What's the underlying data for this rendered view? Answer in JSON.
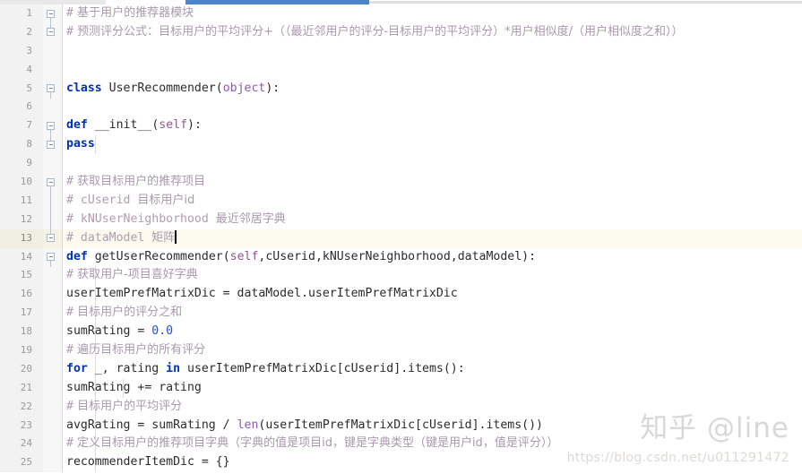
{
  "editor": {
    "language": "python",
    "current_line": 13,
    "gutter_bg": "#f2f2f2",
    "current_line_bg": "#fcfaef",
    "scrollbar": {
      "thumb_color": "#4a86c8",
      "track_color": "#e0e0e0"
    }
  },
  "lines": [
    {
      "num": "1",
      "fold": "start",
      "tokens": [
        {
          "c": "comment",
          "t": "#"
        },
        {
          "c": "comment-cn",
          "t": " 基于用户的推荐器模块"
        }
      ]
    },
    {
      "num": "2",
      "fold": "end",
      "tokens": [
        {
          "c": "comment",
          "t": "#"
        },
        {
          "c": "comment-cn",
          "t": " 预测评分公式：目标用户的平均评分+（（最近邻用户的评分-目标用户的平均评分）*用户相似度/（用户相似度之和））"
        }
      ]
    },
    {
      "num": "3",
      "fold": "none",
      "tokens": []
    },
    {
      "num": "4",
      "fold": "none",
      "tokens": []
    },
    {
      "num": "5",
      "fold": "start",
      "tokens": [
        {
          "c": "kw",
          "t": "class"
        },
        {
          "c": "plain",
          "t": " "
        },
        {
          "c": "cls",
          "t": "UserRecommender"
        },
        {
          "c": "plain",
          "t": "("
        },
        {
          "c": "builtin",
          "t": "object"
        },
        {
          "c": "plain",
          "t": "):"
        }
      ]
    },
    {
      "num": "6",
      "fold": "none",
      "tokens": []
    },
    {
      "num": "7",
      "fold": "start",
      "indent": 1,
      "tokens": [
        {
          "c": "plain",
          "t": "    "
        },
        {
          "c": "def",
          "t": "def"
        },
        {
          "c": "plain",
          "t": " "
        },
        {
          "c": "fn",
          "t": "__init__"
        },
        {
          "c": "plain",
          "t": "("
        },
        {
          "c": "self",
          "t": "self"
        },
        {
          "c": "plain",
          "t": "):"
        }
      ]
    },
    {
      "num": "8",
      "fold": "end",
      "indent": 2,
      "tokens": [
        {
          "c": "plain",
          "t": "        "
        },
        {
          "c": "kw",
          "t": "pass"
        }
      ]
    },
    {
      "num": "9",
      "fold": "none",
      "tokens": []
    },
    {
      "num": "10",
      "fold": "start",
      "indent": 1,
      "tokens": [
        {
          "c": "plain",
          "t": "    "
        },
        {
          "c": "comment",
          "t": "#"
        },
        {
          "c": "comment-cn",
          "t": " 获取目标用户的推荐项目"
        }
      ]
    },
    {
      "num": "11",
      "fold": "line",
      "indent": 1,
      "tokens": [
        {
          "c": "plain",
          "t": "    "
        },
        {
          "c": "comment",
          "t": "# cUserid "
        },
        {
          "c": "comment-cn",
          "t": "目标用户id"
        }
      ]
    },
    {
      "num": "12",
      "fold": "line",
      "indent": 1,
      "tokens": [
        {
          "c": "plain",
          "t": "    "
        },
        {
          "c": "comment",
          "t": "# kNUserNeighborhood "
        },
        {
          "c": "comment-cn",
          "t": "最近邻居字典"
        }
      ]
    },
    {
      "num": "13",
      "fold": "end",
      "indent": 1,
      "current": true,
      "caret": true,
      "tokens": [
        {
          "c": "plain",
          "t": "    "
        },
        {
          "c": "comment",
          "t": "# dataModel "
        },
        {
          "c": "comment-cn",
          "t": "矩阵"
        }
      ]
    },
    {
      "num": "14",
      "fold": "start",
      "indent": 1,
      "tokens": [
        {
          "c": "plain",
          "t": "    "
        },
        {
          "c": "def",
          "t": "def"
        },
        {
          "c": "plain",
          "t": " "
        },
        {
          "c": "fn",
          "t": "getUserRecommender"
        },
        {
          "c": "plain",
          "t": "("
        },
        {
          "c": "self",
          "t": "self"
        },
        {
          "c": "plain",
          "t": ",cUserid,kNUserNeighborhood,dataModel):"
        }
      ]
    },
    {
      "num": "15",
      "fold": "none",
      "indent": 2,
      "tokens": [
        {
          "c": "plain",
          "t": "        "
        },
        {
          "c": "comment",
          "t": "#"
        },
        {
          "c": "comment-cn",
          "t": " 获取用户-项目喜好字典"
        }
      ]
    },
    {
      "num": "16",
      "fold": "none",
      "indent": 2,
      "tokens": [
        {
          "c": "plain",
          "t": "        userItemPrefMatrixDic = dataModel.userItemPrefMatrixDic"
        }
      ]
    },
    {
      "num": "17",
      "fold": "none",
      "indent": 2,
      "tokens": [
        {
          "c": "plain",
          "t": "        "
        },
        {
          "c": "comment",
          "t": "#"
        },
        {
          "c": "comment-cn",
          "t": " 目标用户的评分之和"
        }
      ]
    },
    {
      "num": "18",
      "fold": "none",
      "indent": 2,
      "tokens": [
        {
          "c": "plain",
          "t": "        sumRating = "
        },
        {
          "c": "num",
          "t": "0.0"
        }
      ]
    },
    {
      "num": "19",
      "fold": "none",
      "indent": 2,
      "tokens": [
        {
          "c": "plain",
          "t": "        "
        },
        {
          "c": "comment",
          "t": "#"
        },
        {
          "c": "comment-cn",
          "t": " 遍历目标用户的所有评分"
        }
      ]
    },
    {
      "num": "20",
      "fold": "none",
      "indent": 2,
      "tokens": [
        {
          "c": "plain",
          "t": "        "
        },
        {
          "c": "kw",
          "t": "for"
        },
        {
          "c": "plain",
          "t": " _, rating "
        },
        {
          "c": "kw",
          "t": "in"
        },
        {
          "c": "plain",
          "t": " userItemPrefMatrixDic[cUserid].items():"
        }
      ]
    },
    {
      "num": "21",
      "fold": "none",
      "indent": 3,
      "tokens": [
        {
          "c": "plain",
          "t": "            sumRating += rating"
        }
      ]
    },
    {
      "num": "22",
      "fold": "none",
      "indent": 2,
      "tokens": [
        {
          "c": "plain",
          "t": "        "
        },
        {
          "c": "comment",
          "t": "#"
        },
        {
          "c": "comment-cn",
          "t": " 目标用户的平均评分"
        }
      ]
    },
    {
      "num": "23",
      "fold": "none",
      "indent": 2,
      "tokens": [
        {
          "c": "plain",
          "t": "        avgRating = sumRating / "
        },
        {
          "c": "builtin",
          "t": "len"
        },
        {
          "c": "plain",
          "t": "(userItemPrefMatrixDic[cUserid].items())"
        }
      ]
    },
    {
      "num": "24",
      "fold": "none",
      "indent": 2,
      "tokens": [
        {
          "c": "plain",
          "t": "        "
        },
        {
          "c": "comment",
          "t": "#"
        },
        {
          "c": "comment-cn",
          "t": " 定义目标用户的推荐项目字典（字典的值是项目id，键是字典类型（键是用户id，值是评分））"
        }
      ]
    },
    {
      "num": "25",
      "fold": "none",
      "indent": 2,
      "tokens": [
        {
          "c": "plain",
          "t": "        recommenderItemDic = {}"
        }
      ]
    }
  ],
  "watermarks": {
    "zhihu": "知乎 @line",
    "csdn": "https://blog.csdn.net/u011291472"
  }
}
